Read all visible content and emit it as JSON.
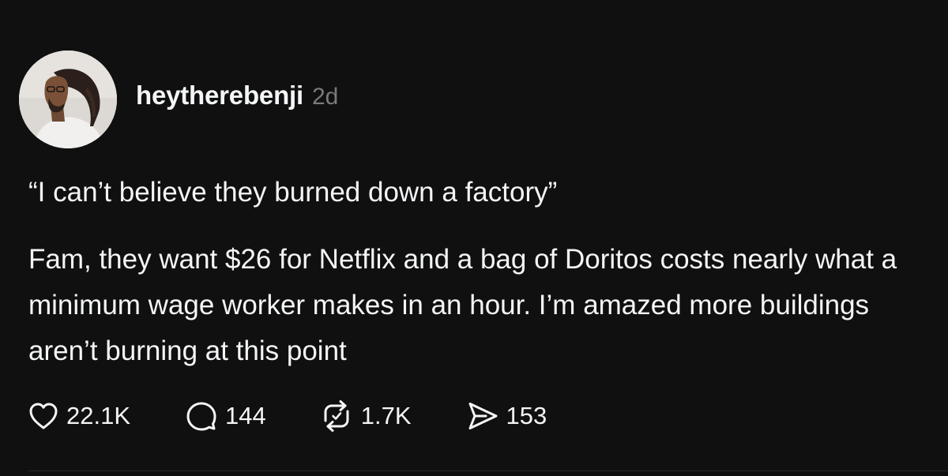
{
  "post": {
    "author": {
      "username": "heytherebenji",
      "timestamp": "2d"
    },
    "paragraphs": [
      "“I can’t believe they burned down a factory”",
      "Fam, they want $26 for Netflix and a bag of Doritos costs nearly what a minimum wage worker makes in an hour. I’m amazed more buildings aren’t burning at this point"
    ],
    "actions": {
      "likes": {
        "icon": "heart-icon",
        "count": "22.1K"
      },
      "replies": {
        "icon": "comment-icon",
        "count": "144"
      },
      "reposts": {
        "icon": "repost-icon",
        "count": "1.7K"
      },
      "shares": {
        "icon": "send-icon",
        "count": "153"
      }
    }
  },
  "colors": {
    "background": "#101010",
    "text": "#f3f5f7",
    "muted": "#7a7a7a"
  }
}
